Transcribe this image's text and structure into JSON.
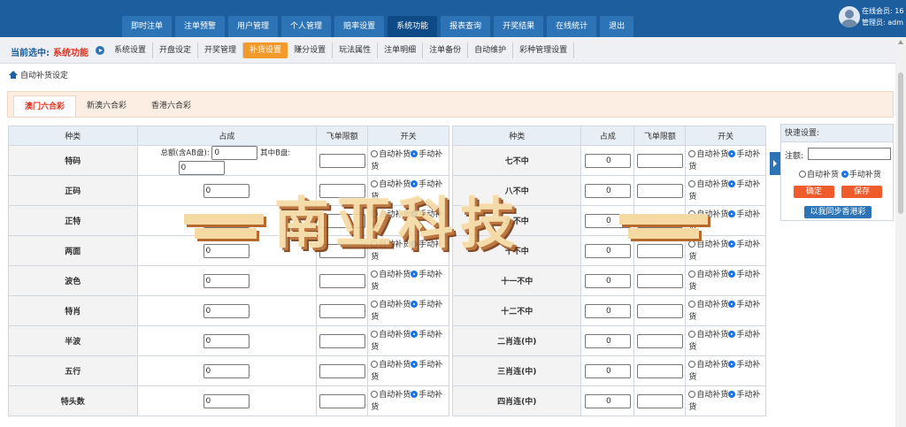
{
  "header": {
    "nav": [
      "即时注单",
      "注单预警",
      "用户管理",
      "个人管理",
      "赔率设置",
      "系统功能",
      "报表查询",
      "开奖结果",
      "在线统计",
      "退出"
    ],
    "active_nav": "系统功能",
    "user": {
      "online_label": "在线会员: 16",
      "admin_label": "管理员: adm"
    }
  },
  "subheader": {
    "current_label": "当前选中:",
    "current_value": "系统功能",
    "items": [
      "系统设置",
      "开盘设定",
      "开奖管理",
      "补货设置",
      "赚分设置",
      "玩法属性",
      "注单明细",
      "注单备份",
      "自动维护",
      "彩种管理设置"
    ],
    "active_item": "补货设置"
  },
  "breadcrumb": "自动补货设定",
  "tabs": [
    "澳门六合彩",
    "新澳六合彩",
    "香港六合彩"
  ],
  "active_tab": "澳门六合彩",
  "table_headers": {
    "kind": "种类",
    "share": "占成",
    "fly_limit": "飞单限额",
    "switch": "开关"
  },
  "first_row": {
    "total_label": "总额(含AB盘):",
    "b_label": "其中B盘:"
  },
  "switch_options": {
    "auto": "自动补货",
    "manual": "手动补货"
  },
  "left_rows": [
    {
      "kind": "特码",
      "value": "0"
    },
    {
      "kind": "正码",
      "value": "0"
    },
    {
      "kind": "正特",
      "value": "0"
    },
    {
      "kind": "两面",
      "value": "0"
    },
    {
      "kind": "波色",
      "value": "0"
    },
    {
      "kind": "特肖",
      "value": "0"
    },
    {
      "kind": "半波",
      "value": "0"
    },
    {
      "kind": "五行",
      "value": "0"
    },
    {
      "kind": "特头数",
      "value": "0"
    }
  ],
  "right_rows": [
    {
      "kind": "七不中",
      "value": "0"
    },
    {
      "kind": "八不中",
      "value": "0"
    },
    {
      "kind": "九不中",
      "value": "0"
    },
    {
      "kind": "十不中",
      "value": "0"
    },
    {
      "kind": "十一不中",
      "value": "0"
    },
    {
      "kind": "十二不中",
      "value": "0"
    },
    {
      "kind": "二肖连(中)",
      "value": "0"
    },
    {
      "kind": "三肖连(中)",
      "value": "0"
    },
    {
      "kind": "四肖连(中)",
      "value": "0"
    }
  ],
  "quick_panel": {
    "title": "快速设置:",
    "amount_label": "注额:",
    "auto": "自动补货",
    "manual": "手动补货",
    "confirm": "确定",
    "save": "保存",
    "sync": "以我同步香港彩"
  },
  "watermark": "南亚科技"
}
